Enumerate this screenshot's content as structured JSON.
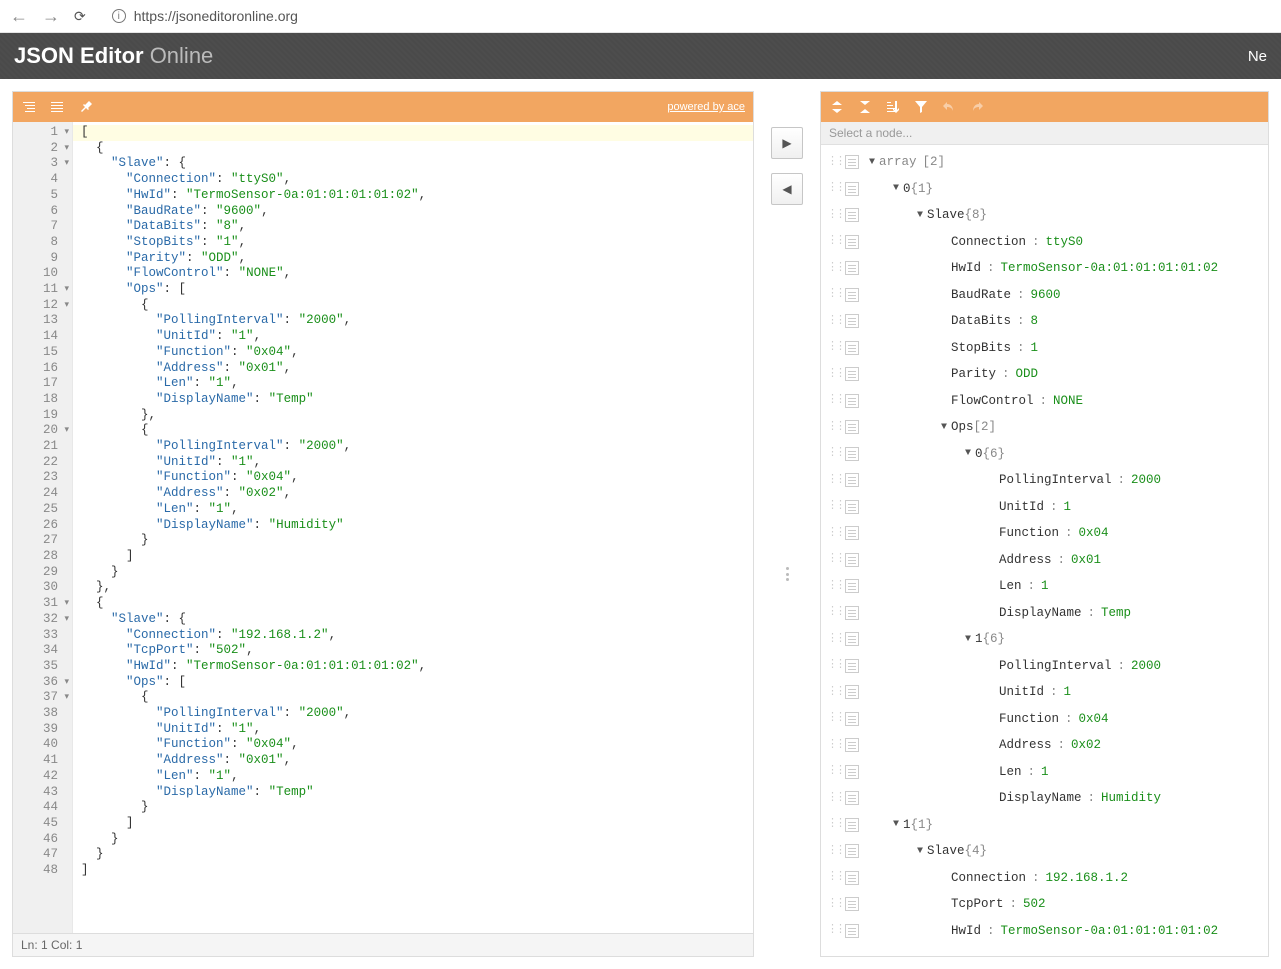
{
  "browser": {
    "url": "https://jsoneditoronline.org"
  },
  "titleBar": {
    "title_strong": "JSON Editor",
    "title_sub": " Online",
    "menu_right": "Ne"
  },
  "leftPanel": {
    "powered_by": "powered by ace",
    "status": "Ln: 1   Col: 1"
  },
  "rightPanel": {
    "searchPlaceholder": "Select a node..."
  },
  "code": {
    "lines": [
      {
        "n": 1,
        "fold": true,
        "text": "["
      },
      {
        "n": 2,
        "fold": true,
        "text": "  {"
      },
      {
        "n": 3,
        "fold": true,
        "text": "    \"Slave\": {",
        "parts": [
          "    ",
          {
            "k": "\"Slave\""
          },
          ": {"
        ]
      },
      {
        "n": 4,
        "text": "      \"Connection\": \"ttyS0\",",
        "parts": [
          "      ",
          {
            "k": "\"Connection\""
          },
          ": ",
          {
            "s": "\"ttyS0\""
          },
          ","
        ]
      },
      {
        "n": 5,
        "text": "",
        "parts": [
          "      ",
          {
            "k": "\"HwId\""
          },
          ": ",
          {
            "s": "\"TermoSensor-0a:01:01:01:01:02\""
          },
          ","
        ]
      },
      {
        "n": 6,
        "text": "",
        "parts": [
          "      ",
          {
            "k": "\"BaudRate\""
          },
          ": ",
          {
            "s": "\"9600\""
          },
          ","
        ]
      },
      {
        "n": 7,
        "text": "",
        "parts": [
          "      ",
          {
            "k": "\"DataBits\""
          },
          ": ",
          {
            "s": "\"8\""
          },
          ","
        ]
      },
      {
        "n": 8,
        "text": "",
        "parts": [
          "      ",
          {
            "k": "\"StopBits\""
          },
          ": ",
          {
            "s": "\"1\""
          },
          ","
        ]
      },
      {
        "n": 9,
        "text": "",
        "parts": [
          "      ",
          {
            "k": "\"Parity\""
          },
          ": ",
          {
            "s": "\"ODD\""
          },
          ","
        ]
      },
      {
        "n": 10,
        "text": "",
        "parts": [
          "      ",
          {
            "k": "\"FlowControl\""
          },
          ": ",
          {
            "s": "\"NONE\""
          },
          ","
        ]
      },
      {
        "n": 11,
        "fold": true,
        "text": "",
        "parts": [
          "      ",
          {
            "k": "\"Ops\""
          },
          ": ["
        ]
      },
      {
        "n": 12,
        "fold": true,
        "text": "        {"
      },
      {
        "n": 13,
        "text": "",
        "parts": [
          "          ",
          {
            "k": "\"PollingInterval\""
          },
          ": ",
          {
            "s": "\"2000\""
          },
          ","
        ]
      },
      {
        "n": 14,
        "text": "",
        "parts": [
          "          ",
          {
            "k": "\"UnitId\""
          },
          ": ",
          {
            "s": "\"1\""
          },
          ","
        ]
      },
      {
        "n": 15,
        "text": "",
        "parts": [
          "          ",
          {
            "k": "\"Function\""
          },
          ": ",
          {
            "s": "\"0x04\""
          },
          ","
        ]
      },
      {
        "n": 16,
        "text": "",
        "parts": [
          "          ",
          {
            "k": "\"Address\""
          },
          ": ",
          {
            "s": "\"0x01\""
          },
          ","
        ]
      },
      {
        "n": 17,
        "text": "",
        "parts": [
          "          ",
          {
            "k": "\"Len\""
          },
          ": ",
          {
            "s": "\"1\""
          },
          ","
        ]
      },
      {
        "n": 18,
        "text": "",
        "parts": [
          "          ",
          {
            "k": "\"DisplayName\""
          },
          ": ",
          {
            "s": "\"Temp\""
          }
        ]
      },
      {
        "n": 19,
        "text": "        },"
      },
      {
        "n": 20,
        "fold": true,
        "text": "        {"
      },
      {
        "n": 21,
        "text": "",
        "parts": [
          "          ",
          {
            "k": "\"PollingInterval\""
          },
          ": ",
          {
            "s": "\"2000\""
          },
          ","
        ]
      },
      {
        "n": 22,
        "text": "",
        "parts": [
          "          ",
          {
            "k": "\"UnitId\""
          },
          ": ",
          {
            "s": "\"1\""
          },
          ","
        ]
      },
      {
        "n": 23,
        "text": "",
        "parts": [
          "          ",
          {
            "k": "\"Function\""
          },
          ": ",
          {
            "s": "\"0x04\""
          },
          ","
        ]
      },
      {
        "n": 24,
        "text": "",
        "parts": [
          "          ",
          {
            "k": "\"Address\""
          },
          ": ",
          {
            "s": "\"0x02\""
          },
          ","
        ]
      },
      {
        "n": 25,
        "text": "",
        "parts": [
          "          ",
          {
            "k": "\"Len\""
          },
          ": ",
          {
            "s": "\"1\""
          },
          ","
        ]
      },
      {
        "n": 26,
        "text": "",
        "parts": [
          "          ",
          {
            "k": "\"DisplayName\""
          },
          ": ",
          {
            "s": "\"Humidity\""
          }
        ]
      },
      {
        "n": 27,
        "text": "        }"
      },
      {
        "n": 28,
        "text": "      ]"
      },
      {
        "n": 29,
        "text": "    }"
      },
      {
        "n": 30,
        "text": "  },"
      },
      {
        "n": 31,
        "fold": true,
        "text": "  {"
      },
      {
        "n": 32,
        "fold": true,
        "text": "",
        "parts": [
          "    ",
          {
            "k": "\"Slave\""
          },
          ": {"
        ]
      },
      {
        "n": 33,
        "text": "",
        "parts": [
          "      ",
          {
            "k": "\"Connection\""
          },
          ": ",
          {
            "s": "\"192.168.1.2\""
          },
          ","
        ]
      },
      {
        "n": 34,
        "text": "",
        "parts": [
          "      ",
          {
            "k": "\"TcpPort\""
          },
          ": ",
          {
            "s": "\"502\""
          },
          ","
        ]
      },
      {
        "n": 35,
        "text": "",
        "parts": [
          "      ",
          {
            "k": "\"HwId\""
          },
          ": ",
          {
            "s": "\"TermoSensor-0a:01:01:01:01:02\""
          },
          ","
        ]
      },
      {
        "n": 36,
        "fold": true,
        "text": "",
        "parts": [
          "      ",
          {
            "k": "\"Ops\""
          },
          ": ["
        ]
      },
      {
        "n": 37,
        "fold": true,
        "text": "        {"
      },
      {
        "n": 38,
        "text": "",
        "parts": [
          "          ",
          {
            "k": "\"PollingInterval\""
          },
          ": ",
          {
            "s": "\"2000\""
          },
          ","
        ]
      },
      {
        "n": 39,
        "text": "",
        "parts": [
          "          ",
          {
            "k": "\"UnitId\""
          },
          ": ",
          {
            "s": "\"1\""
          },
          ","
        ]
      },
      {
        "n": 40,
        "text": "",
        "parts": [
          "          ",
          {
            "k": "\"Function\""
          },
          ": ",
          {
            "s": "\"0x04\""
          },
          ","
        ]
      },
      {
        "n": 41,
        "text": "",
        "parts": [
          "          ",
          {
            "k": "\"Address\""
          },
          ": ",
          {
            "s": "\"0x01\""
          },
          ","
        ]
      },
      {
        "n": 42,
        "text": "",
        "parts": [
          "          ",
          {
            "k": "\"Len\""
          },
          ": ",
          {
            "s": "\"1\""
          },
          ","
        ]
      },
      {
        "n": 43,
        "text": "",
        "parts": [
          "          ",
          {
            "k": "\"DisplayName\""
          },
          ": ",
          {
            "s": "\"Temp\""
          }
        ]
      },
      {
        "n": 44,
        "text": "        }"
      },
      {
        "n": 45,
        "text": "      ]"
      },
      {
        "n": 46,
        "text": "    }"
      },
      {
        "n": 47,
        "text": "  }"
      },
      {
        "n": 48,
        "text": "]"
      }
    ]
  },
  "tree": {
    "rows": [
      {
        "indent": 0,
        "exp": "▼",
        "key": "array",
        "meta": "[2]",
        "topMenu": true
      },
      {
        "indent": 1,
        "exp": "▼",
        "key": "0",
        "meta": "{1}"
      },
      {
        "indent": 2,
        "exp": "▼",
        "key": "Slave",
        "meta": "{8}"
      },
      {
        "indent": 3,
        "key": "Connection",
        "val": "ttyS0"
      },
      {
        "indent": 3,
        "key": "HwId",
        "val": "TermoSensor-0a:01:01:01:01:02"
      },
      {
        "indent": 3,
        "key": "BaudRate",
        "val": "9600"
      },
      {
        "indent": 3,
        "key": "DataBits",
        "val": "8"
      },
      {
        "indent": 3,
        "key": "StopBits",
        "val": "1"
      },
      {
        "indent": 3,
        "key": "Parity",
        "val": "ODD"
      },
      {
        "indent": 3,
        "key": "FlowControl",
        "val": "NONE"
      },
      {
        "indent": 3,
        "exp": "▼",
        "key": "Ops",
        "meta": "[2]"
      },
      {
        "indent": 4,
        "exp": "▼",
        "key": "0",
        "meta": "{6}"
      },
      {
        "indent": 5,
        "key": "PollingInterval",
        "val": "2000"
      },
      {
        "indent": 5,
        "key": "UnitId",
        "val": "1"
      },
      {
        "indent": 5,
        "key": "Function",
        "val": "0x04"
      },
      {
        "indent": 5,
        "key": "Address",
        "val": "0x01"
      },
      {
        "indent": 5,
        "key": "Len ",
        "val": "1"
      },
      {
        "indent": 5,
        "key": "DisplayName",
        "val": "Temp"
      },
      {
        "indent": 4,
        "exp": "▼",
        "key": "1",
        "meta": "{6}"
      },
      {
        "indent": 5,
        "key": "PollingInterval",
        "val": "2000"
      },
      {
        "indent": 5,
        "key": "UnitId",
        "val": "1"
      },
      {
        "indent": 5,
        "key": "Function",
        "val": "0x04"
      },
      {
        "indent": 5,
        "key": "Address",
        "val": "0x02"
      },
      {
        "indent": 5,
        "key": "Len ",
        "val": "1"
      },
      {
        "indent": 5,
        "key": "DisplayName",
        "val": "Humidity"
      },
      {
        "indent": 1,
        "exp": "▼",
        "key": "1",
        "meta": "{1}"
      },
      {
        "indent": 2,
        "exp": "▼",
        "key": "Slave",
        "meta": "{4}"
      },
      {
        "indent": 3,
        "key": "Connection",
        "val": "192.168.1.2"
      },
      {
        "indent": 3,
        "key": "TcpPort",
        "val": "502"
      },
      {
        "indent": 3,
        "key": "HwId",
        "val": "TermoSensor-0a:01:01:01:01:02"
      }
    ]
  }
}
